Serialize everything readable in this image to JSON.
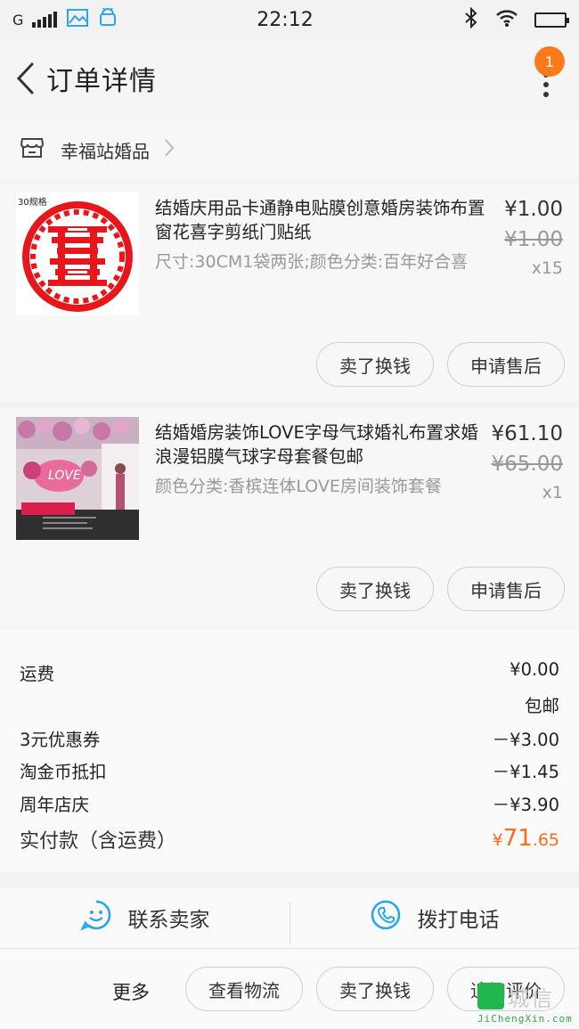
{
  "status_bar": {
    "carrier": "G",
    "time": "22:12",
    "battery_color": "#39b54a"
  },
  "nav": {
    "title": "订单详情",
    "badge": "1",
    "badge_color": "#ff7a1a"
  },
  "shop": {
    "name": "幸福站婚品"
  },
  "items": [
    {
      "thumb_label": "30规格",
      "title": "结婚庆用品卡通静电贴膜创意婚房装饰布置窗花喜字剪纸门贴纸",
      "spec": "尺寸:30CM1袋两张;颜色分类:百年好合喜",
      "price": "¥1.00",
      "original_price": "¥1.00",
      "quantity": "x15",
      "action_sell": "卖了换钱",
      "action_aftersale": "申请售后"
    },
    {
      "title": "结婚婚房装饰LOVE字母气球婚礼布置求婚浪漫铝膜气球字母套餐包邮",
      "spec": "颜色分类:香槟连体LOVE房间装饰套餐",
      "price": "¥61.10",
      "original_price": "¥65.00",
      "quantity": "x1",
      "action_sell": "卖了换钱",
      "action_aftersale": "申请售后"
    }
  ],
  "summary": {
    "shipping_label": "运费",
    "shipping_value": "¥0.00",
    "shipping_note": "包邮",
    "rows": [
      {
        "label": "3元优惠券",
        "value": "－¥3.00"
      },
      {
        "label": "淘金币抵扣",
        "value": "－¥1.45"
      },
      {
        "label": "周年店庆",
        "value": "－¥3.90"
      }
    ],
    "total_label": "实付款（含运费）",
    "total_currency": "¥",
    "total_integer": "71",
    "total_decimal": ".65",
    "total_color": "#ff6a1a"
  },
  "contact": {
    "seller": "联系卖家",
    "phone": "拨打电话",
    "icon_color": "#2aa7e8"
  },
  "actions": {
    "more": "更多",
    "logistics": "查看物流",
    "sell": "卖了换钱",
    "review": "追加评价"
  },
  "watermark": {
    "text": "城信",
    "url": "JiChengXin.com"
  }
}
